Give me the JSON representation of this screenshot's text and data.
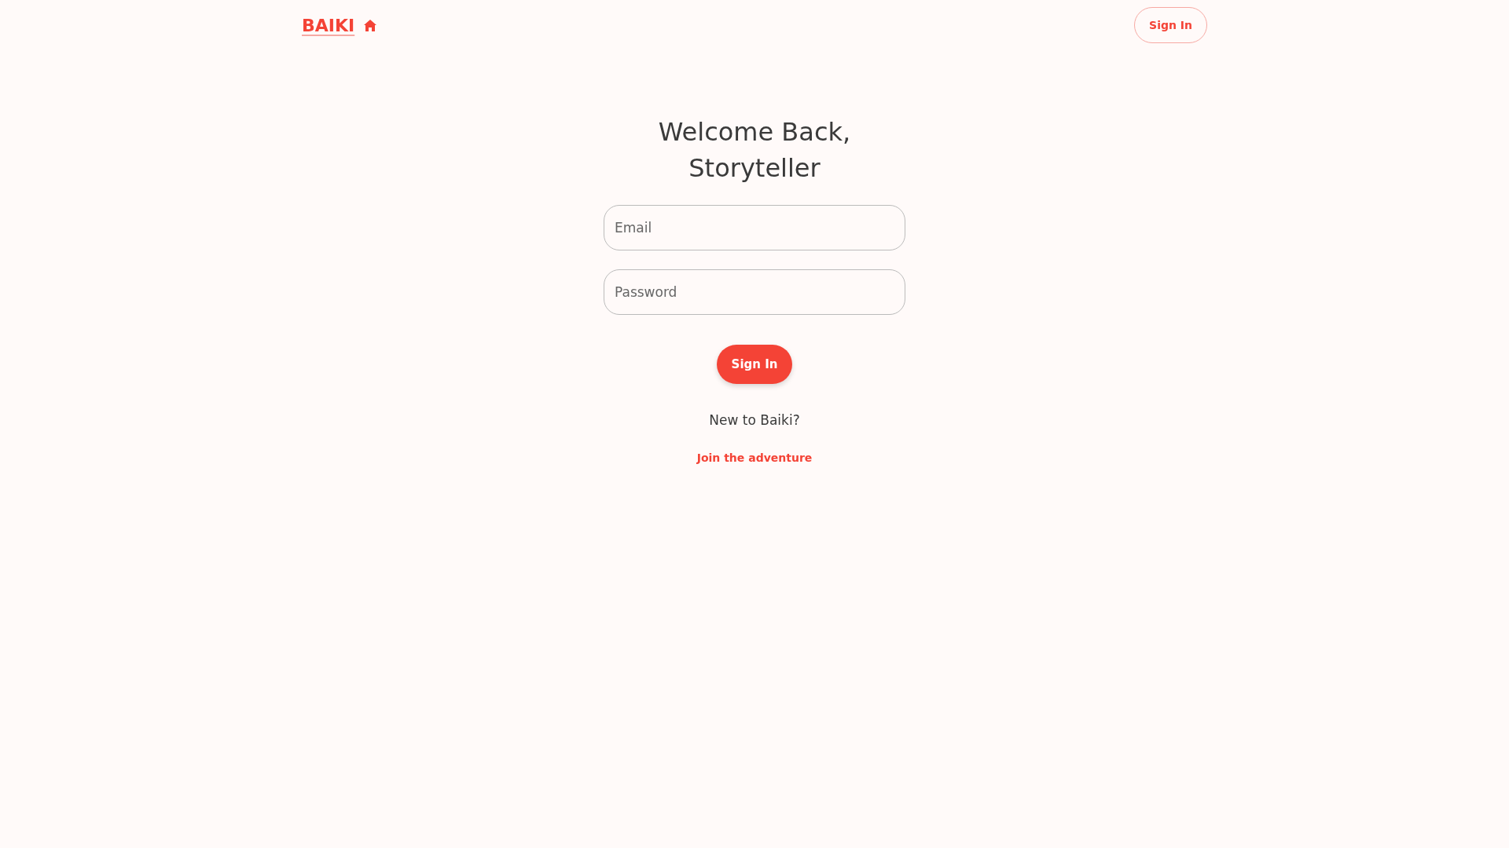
{
  "navbar": {
    "brand": "BAIKI",
    "sign_in": "Sign In"
  },
  "form": {
    "title_lines": [
      "Welcome Back,",
      "Storyteller"
    ],
    "fields": [
      {
        "placeholder": "Email"
      },
      {
        "placeholder": "Password"
      }
    ],
    "submit": "Sign In",
    "prompt": "New to Baiki?",
    "link": "Join the adventure"
  }
}
